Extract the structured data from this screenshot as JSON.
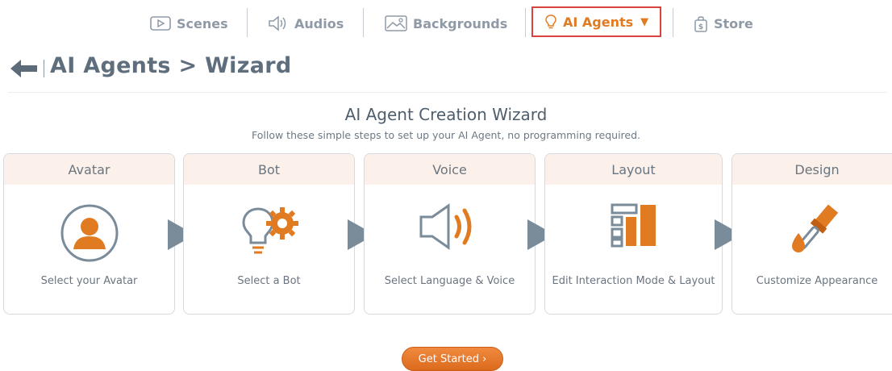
{
  "nav": {
    "scenes": "Scenes",
    "audios": "Audios",
    "backgrounds": "Backgrounds",
    "ai_agents": "AI Agents",
    "ai_agents_caret": "▼",
    "store": "Store"
  },
  "header": {
    "title": "AI Agents > Wizard"
  },
  "wizard": {
    "title": "AI Agent Creation Wizard",
    "subtitle": "Follow these simple steps to set up your AI Agent, no programming required.",
    "steps": [
      {
        "header": "Avatar",
        "label": "Select your Avatar",
        "icon": "person-icon"
      },
      {
        "header": "Bot",
        "label": "Select a Bot",
        "icon": "lightbulb-gear-icon"
      },
      {
        "header": "Voice",
        "label": "Select Language & Voice",
        "icon": "speaker-icon"
      },
      {
        "header": "Layout",
        "label": "Edit Interaction Mode & Layout",
        "icon": "layout-grid-icon"
      },
      {
        "header": "Design",
        "label": "Customize Appearance",
        "icon": "paint-brush-icon"
      }
    ],
    "cta": "Get Started ›"
  },
  "colors": {
    "accent": "#e07b22",
    "active_border": "#d9433f",
    "card_header_bg": "#fbf1ea",
    "arrow": "#7a8b9a",
    "text": "#5f6e7d"
  }
}
